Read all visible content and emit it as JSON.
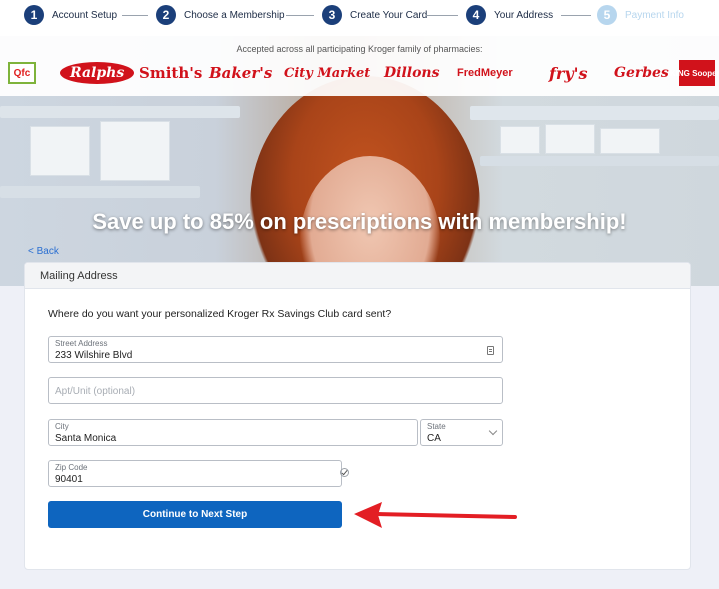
{
  "stepper": {
    "steps": [
      {
        "num": "1",
        "label": "Account Setup"
      },
      {
        "num": "2",
        "label": "Choose a Membership"
      },
      {
        "num": "3",
        "label": "Create Your Card"
      },
      {
        "num": "4",
        "label": "Your Address"
      },
      {
        "num": "5",
        "label": "Payment Info"
      }
    ]
  },
  "hero": {
    "accepted_text": "Accepted across all participating Kroger family of pharmacies:",
    "logos": [
      "Qfc",
      "Ralphs",
      "Smith's",
      "Baker's",
      "City Market",
      "Dillons",
      "FredMeyer",
      "fry's",
      "Gerbes",
      "KING Soopers"
    ],
    "headline": "Save up to 85% on prescriptions with membership!",
    "back_link": "< Back"
  },
  "card": {
    "header": "Mailing Address",
    "prompt": "Where do you want your personalized Kroger Rx Savings Club card sent?",
    "street": {
      "label": "Street Address",
      "value": "233 Wilshire Blvd"
    },
    "apt": {
      "placeholder": "Apt/Unit (optional)"
    },
    "city": {
      "label": "City",
      "value": "Santa Monica"
    },
    "state": {
      "label": "State",
      "value": "CA"
    },
    "zip": {
      "label": "Zip Code",
      "value": "90401"
    },
    "continue_label": "Continue to Next Step"
  },
  "colors": {
    "primary_button": "#0e65bf",
    "step_active": "#1b3f7a",
    "step_disabled": "#b7d6ee",
    "annotation_arrow": "#e31e24"
  }
}
